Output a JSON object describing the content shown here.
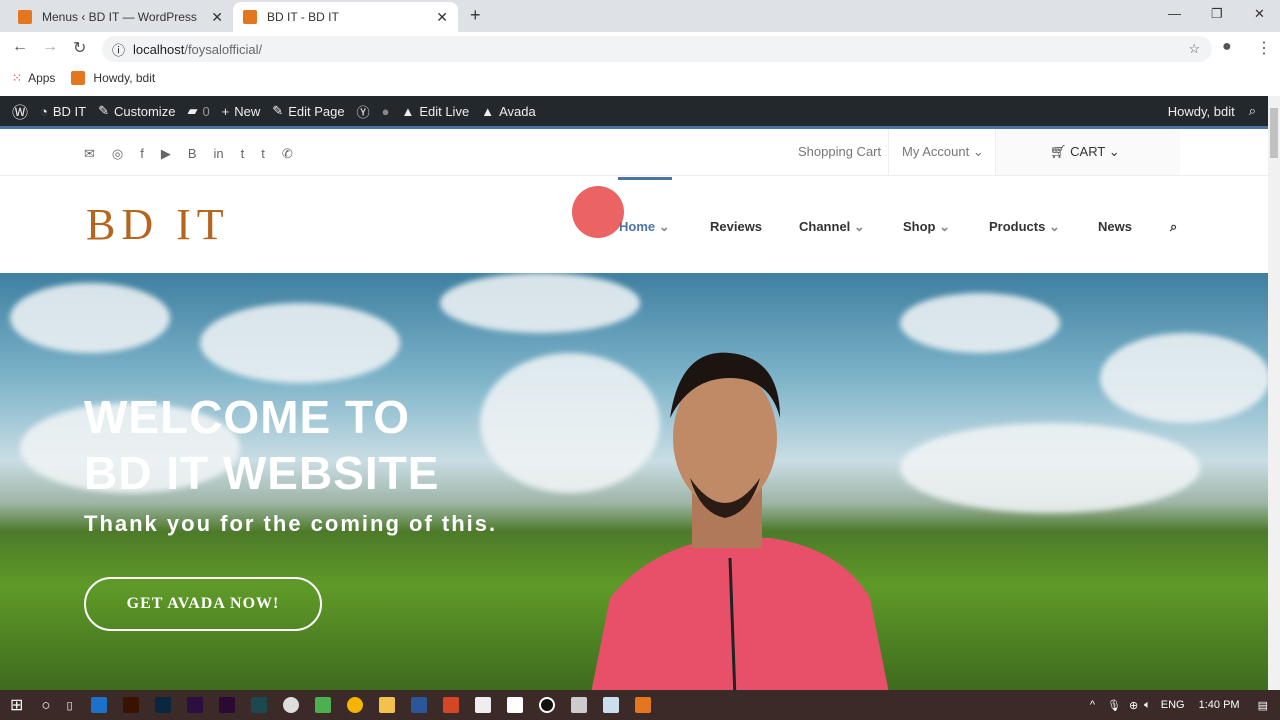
{
  "browser": {
    "tabs": [
      {
        "title": "Menus ‹ BD IT — WordPress",
        "active": false
      },
      {
        "title": "BD IT - BD IT",
        "active": true
      }
    ],
    "url_host": "localhost",
    "url_path": "/foysalofficial/",
    "bookmarks": [
      {
        "label": "Apps"
      },
      {
        "label": "Howdy, bdit"
      }
    ]
  },
  "wp_admin_bar": {
    "items": [
      "BD IT",
      "Customize",
      "0",
      "New",
      "Edit Page",
      "Edit Live",
      "Avada"
    ],
    "howdy": "Howdy, bdit"
  },
  "topbar": {
    "social_icons": [
      "mail-icon",
      "instagram-icon",
      "facebook-icon",
      "youtube-icon",
      "blogger-icon",
      "linkedin-icon",
      "twitter-icon",
      "tumblr-icon",
      "phone-icon"
    ],
    "shopping_cart": "Shopping Cart",
    "my_account": "My Account",
    "cart": "CART"
  },
  "header": {
    "logo": "BD IT",
    "menu": [
      {
        "label": "Home",
        "active": true,
        "dropdown": true
      },
      {
        "label": "Reviews",
        "dropdown": false
      },
      {
        "label": "Channel",
        "dropdown": true
      },
      {
        "label": "Shop",
        "dropdown": true
      },
      {
        "label": "Products",
        "dropdown": true
      },
      {
        "label": "News",
        "dropdown": false
      }
    ]
  },
  "hero": {
    "title_line1": "WELCOME TO",
    "title_line2": "BD IT WEBSITE",
    "subtitle": "Thank you for the coming of this.",
    "cta": "GET AVADA NOW!"
  },
  "taskbar": {
    "language": "ENG",
    "time": "1:40 PM"
  },
  "colors": {
    "accent": "#4a74a8",
    "logo": "#b5651d",
    "admin_bar": "#23282d"
  }
}
